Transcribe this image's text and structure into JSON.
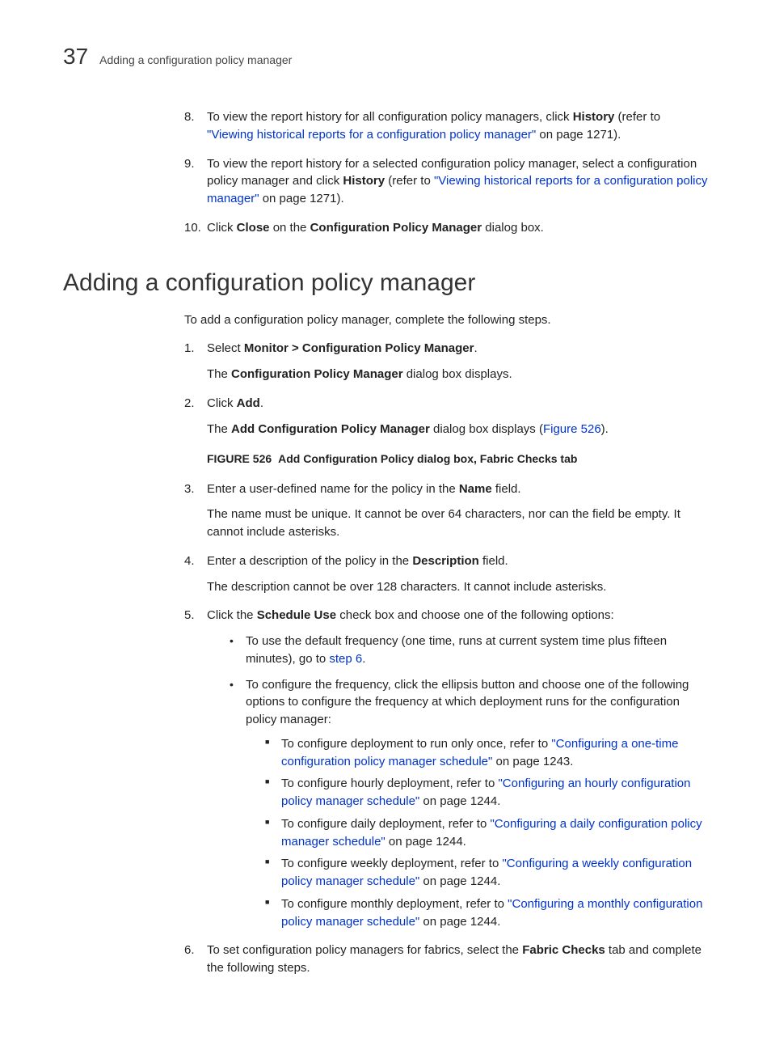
{
  "header": {
    "chapter_number": "37",
    "running_title": "Adding a configuration policy manager"
  },
  "top_steps": {
    "s8": {
      "num": "8.",
      "t1": "To view the report history for all configuration policy managers, click ",
      "b1": "History",
      "t2": " (refer to ",
      "link": "\"Viewing historical reports for a configuration policy manager\"",
      "t3": " on page 1271)."
    },
    "s9": {
      "num": "9.",
      "t1": "To view the report history for a selected configuration policy manager, select a configuration policy manager and click ",
      "b1": "History",
      "t2": " (refer to ",
      "link": "\"Viewing historical reports for a configuration policy manager\"",
      "t3": " on page 1271)."
    },
    "s10": {
      "num": "10.",
      "t1": "Click ",
      "b1": "Close",
      "t2": " on the ",
      "b2": "Configuration Policy Manager",
      "t3": " dialog box."
    }
  },
  "section_title": "Adding a configuration policy manager",
  "intro": "To add a configuration policy manager, complete the following steps.",
  "steps": {
    "s1": {
      "num": "1.",
      "t1": "Select ",
      "b1": "Monitor > Configuration Policy Manager",
      "t2": ".",
      "p_t1": "The ",
      "p_b1": "Configuration Policy Manager",
      "p_t2": " dialog box displays."
    },
    "s2": {
      "num": "2.",
      "t1": "Click ",
      "b1": "Add",
      "t2": ".",
      "p_t1": "The ",
      "p_b1": "Add Configuration Policy Manager",
      "p_t2": " dialog box displays (",
      "p_link": "Figure 526",
      "p_t3": ")."
    },
    "fig": {
      "label": "FIGURE 526",
      "title": "Add Configuration Policy dialog box, Fabric Checks tab"
    },
    "s3": {
      "num": "3.",
      "t1": "Enter a user-defined name for the policy in the ",
      "b1": "Name",
      "t2": " field.",
      "p": "The name must be unique. It cannot be over 64 characters, nor can the field be empty. It cannot include asterisks."
    },
    "s4": {
      "num": "4.",
      "t1": "Enter a description of the policy in the ",
      "b1": "Description",
      "t2": " field.",
      "p": "The description cannot be over 128 characters. It cannot include asterisks."
    },
    "s5": {
      "num": "5.",
      "t1": "Click the ",
      "b1": "Schedule Use",
      "t2": " check box and choose one of the following options:",
      "bul1": {
        "t1": "To use the default frequency (one time, runs at current system time plus fifteen minutes), go to ",
        "link": "step 6",
        "t2": "."
      },
      "bul2": "To configure the frequency, click the ellipsis button and choose one of the following options to configure the frequency at which deployment runs for the configuration policy manager:",
      "sq1": {
        "t1": "To configure deployment to run only once, refer to ",
        "link": "\"Configuring a one-time configuration policy manager schedule\"",
        "t2": " on page 1243."
      },
      "sq2": {
        "t1": "To configure hourly deployment, refer to ",
        "link": "\"Configuring an hourly configuration policy manager schedule\"",
        "t2": " on page 1244."
      },
      "sq3": {
        "t1": "To configure daily deployment, refer to ",
        "link": "\"Configuring a daily configuration policy manager schedule\"",
        "t2": " on page 1244."
      },
      "sq4": {
        "t1": "To configure weekly deployment, refer to ",
        "link": "\"Configuring a weekly configuration policy manager schedule\"",
        "t2": " on page 1244."
      },
      "sq5": {
        "t1": "To configure monthly deployment, refer to ",
        "link": "\"Configuring a monthly configuration policy manager schedule\"",
        "t2": " on page 1244."
      }
    },
    "s6": {
      "num": "6.",
      "t1": "To set configuration policy managers for fabrics, select the ",
      "b1": "Fabric Checks",
      "t2": " tab and complete the following steps."
    }
  }
}
